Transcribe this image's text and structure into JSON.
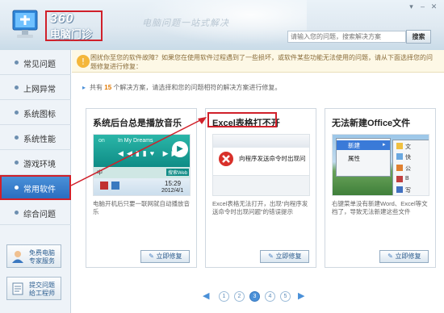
{
  "header": {
    "logo_number": "360",
    "logo_text": "电脑门诊",
    "tagline": "电脑问题一站式解决",
    "search_placeholder": "请输入您的问题，搜索解决方案",
    "search_button": "搜索"
  },
  "notice": {
    "text": "困扰你至您的软件故障？如果您在使用软件过程遇到了一些损坏，或软件某些功能无法使用的问题，请从下面选择您的问题修复进行修复："
  },
  "sidebar": {
    "items": [
      {
        "label": "常见问题"
      },
      {
        "label": "上网异常"
      },
      {
        "label": "系统图标"
      },
      {
        "label": "系统性能"
      },
      {
        "label": "游戏环境"
      },
      {
        "label": "常用软件"
      },
      {
        "label": "综合问题"
      }
    ],
    "active_index": 5,
    "expert_btn": {
      "line1": "免费电脑",
      "line2": "专家服务"
    },
    "submit_btn": {
      "line1": "提交问题",
      "line2": "给工程师"
    }
  },
  "summary": {
    "prefix": "共有",
    "count": "15",
    "suffix": "个解决方案，请选择和您的问题相符的解决方案进行修复。"
  },
  "cards": [
    {
      "title": "系统后台总是播放音乐",
      "desc": "电脑开机后只要一联网就自动播放音乐",
      "fix": "立即修复",
      "shot": {
        "on": "on",
        "song": "In My Dreams",
        "cn": "中",
        "time": "15:29",
        "date": "2012/4/1",
        "link": "搜索Web"
      }
    },
    {
      "title": "Excel表格打不开",
      "desc": "Excel表格无法打开，出现“向程序发送命令时出现问题”的错误提示",
      "fix": "立即修复",
      "shot": {
        "error": "向程序发送命令时出现问"
      }
    },
    {
      "title": "无法新建Office文件",
      "desc": "右键菜单没有新建Word、Excel等文档了，导致无法新建这些文件",
      "fix": "立即修复",
      "shot": {
        "menu_new": "新建",
        "menu_props": "属性",
        "sub1": "文",
        "sub2": "快",
        "sub3": "公",
        "sub4": "B",
        "sub5": "写"
      }
    }
  ],
  "pager": {
    "pages": [
      "1",
      "2",
      "3",
      "4",
      "5"
    ],
    "active": "3",
    "prev": "◀",
    "next": "▶"
  }
}
